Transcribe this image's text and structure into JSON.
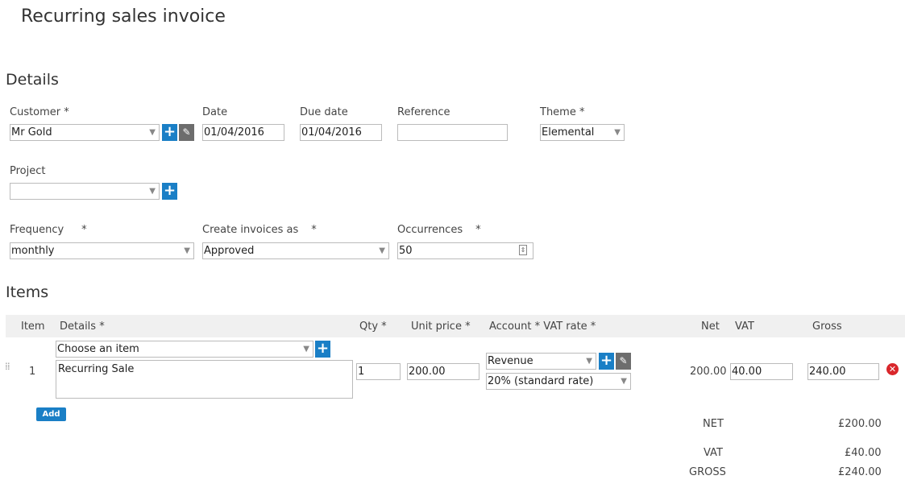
{
  "page": {
    "title": "Recurring sales invoice"
  },
  "details": {
    "heading": "Details",
    "customer": {
      "label": "Customer *",
      "value": "Mr Gold"
    },
    "date": {
      "label": "Date",
      "value": "01/04/2016"
    },
    "due_date": {
      "label": "Due date",
      "value": "01/04/2016"
    },
    "reference": {
      "label": "Reference",
      "value": ""
    },
    "theme": {
      "label": "Theme *",
      "value": "Elemental"
    },
    "project": {
      "label": "Project",
      "value": ""
    },
    "frequency": {
      "label": "Frequency",
      "required": "*",
      "value": "monthly"
    },
    "create_as": {
      "label": "Create invoices as",
      "required": "*",
      "value": "Approved"
    },
    "occurrences": {
      "label": "Occurrences",
      "required": "*",
      "value": "50"
    }
  },
  "items": {
    "heading": "Items",
    "columns": {
      "item": "Item",
      "details": "Details *",
      "qty": "Qty *",
      "unit_price": "Unit price *",
      "account_vat": "Account * VAT rate *",
      "net": "Net",
      "vat": "VAT",
      "gross": "Gross"
    },
    "rows": [
      {
        "number": "1",
        "item_select": "Choose an item",
        "description": "Recurring Sale",
        "qty": "1",
        "unit_price": "200.00",
        "account": "Revenue",
        "vat_rate": "20% (standard rate)",
        "net": "200.00",
        "vat": "40.00",
        "gross": "240.00"
      }
    ],
    "add_label": "Add"
  },
  "totals": {
    "net_label": "NET",
    "net_value": "£200.00",
    "vat_label": "VAT",
    "vat_value": "£40.00",
    "gross_label": "GROSS",
    "gross_value": "£240.00"
  },
  "colors": {
    "accent": "#1a7fc6",
    "edit": "#6d6d6d",
    "delete": "#d9262b",
    "header_bg": "#f0f0f0"
  },
  "icons": {
    "add": "plus-icon",
    "edit": "pencil-icon",
    "delete": "remove-icon",
    "drag": "drag-handle-icon",
    "dropdown": "chevron-down-icon"
  }
}
